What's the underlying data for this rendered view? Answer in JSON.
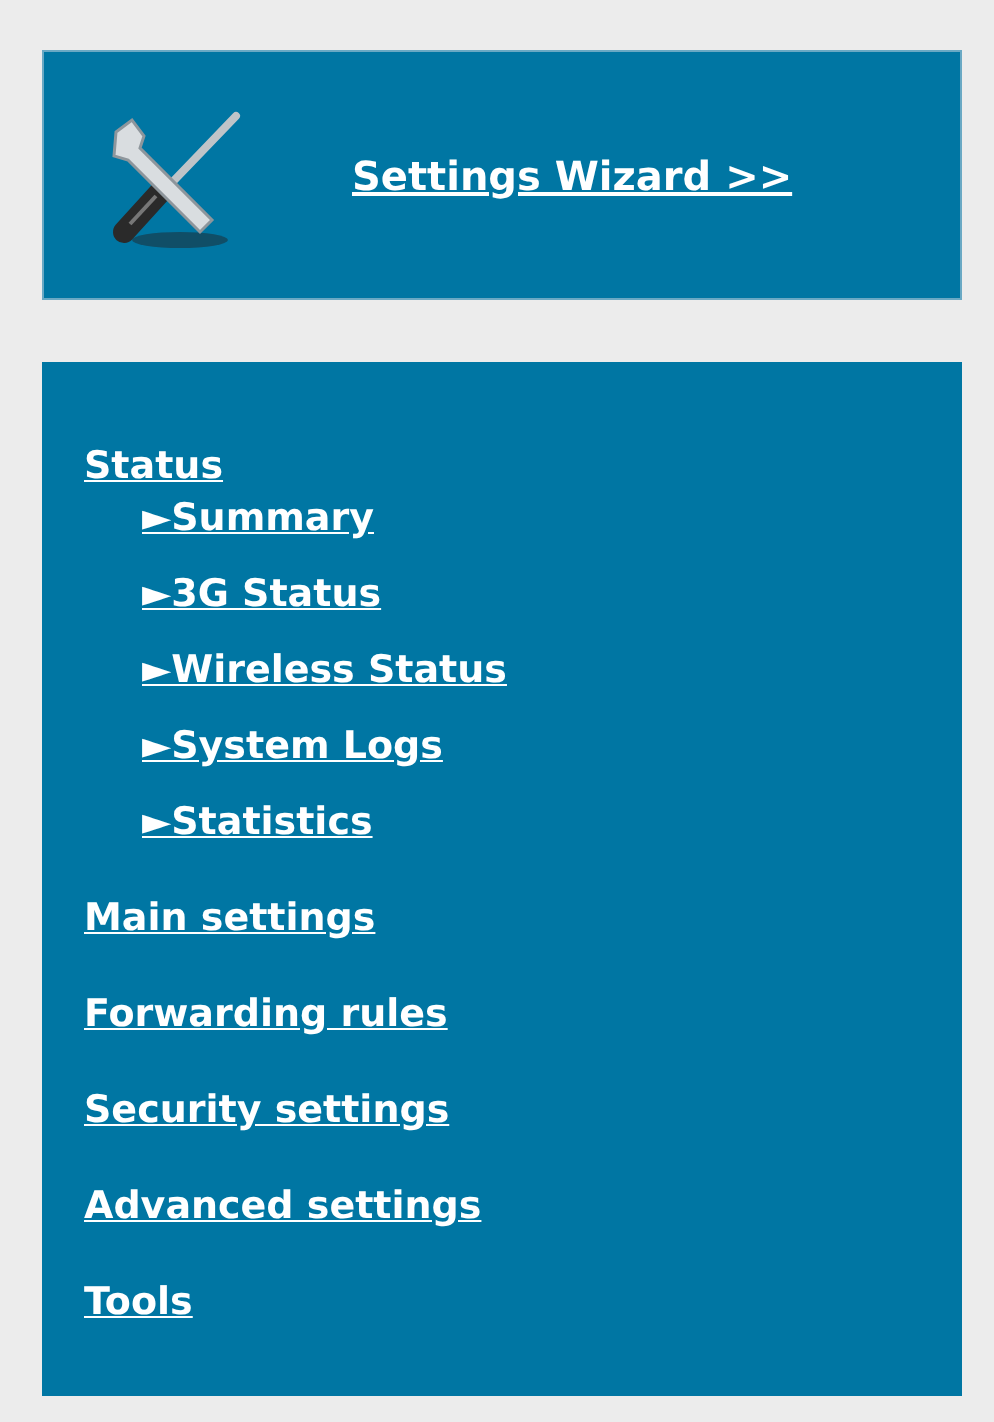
{
  "wizard": {
    "label": "Settings Wizard >>"
  },
  "menu": [
    {
      "label": "Status",
      "children": [
        {
          "label": "►Summary"
        },
        {
          "label": "►3G Status"
        },
        {
          "label": "►Wireless Status"
        },
        {
          "label": "►System Logs"
        },
        {
          "label": "►Statistics"
        }
      ]
    },
    {
      "label": "Main settings"
    },
    {
      "label": "Forwarding rules"
    },
    {
      "label": "Security settings"
    },
    {
      "label": "Advanced settings"
    },
    {
      "label": "Tools"
    }
  ]
}
